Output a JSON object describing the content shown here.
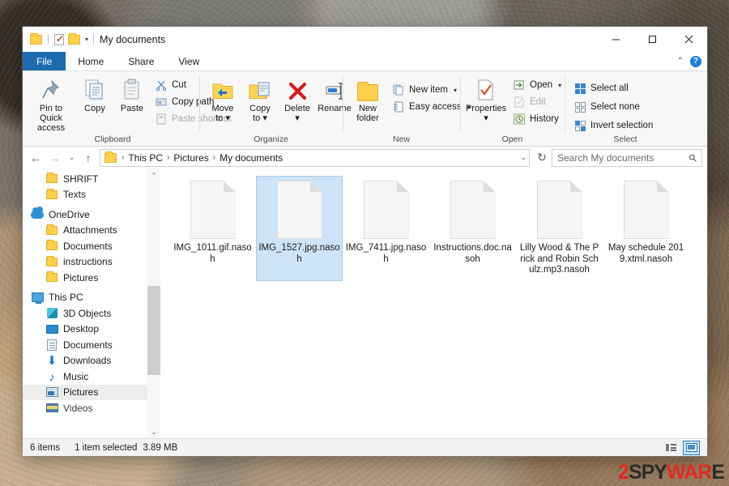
{
  "window": {
    "title": "My documents",
    "quick_access": [
      {
        "name": "folder-icon",
        "label": "Folder"
      },
      {
        "name": "properties-icon",
        "label": "Properties"
      },
      {
        "name": "new-folder-icon",
        "label": "New folder"
      },
      {
        "name": "customize-qat-caret",
        "label": "▾"
      }
    ],
    "controls": {
      "minimize": "—",
      "maximize": "▢",
      "close": "✕"
    }
  },
  "tabs": [
    {
      "id": "file",
      "label": "File"
    },
    {
      "id": "home",
      "label": "Home"
    },
    {
      "id": "share",
      "label": "Share"
    },
    {
      "id": "view",
      "label": "View"
    }
  ],
  "ribbon": {
    "collapse_caret": "⌃",
    "help_label": "?",
    "groups": [
      {
        "name": "Clipboard",
        "label": "Clipboard",
        "big_buttons": [
          {
            "name": "pin-to-quick-access",
            "label": "Pin to Quick\naccess",
            "line1": "Pin to Quick",
            "line2": "access"
          },
          {
            "name": "copy",
            "label": "Copy",
            "line1": "Copy",
            "line2": ""
          },
          {
            "name": "paste",
            "label": "Paste",
            "line1": "Paste",
            "line2": ""
          }
        ],
        "small_buttons": [
          {
            "name": "cut",
            "label": "Cut"
          },
          {
            "name": "copy-path",
            "label": "Copy path"
          },
          {
            "name": "paste-shortcut",
            "label": "Paste shortcut"
          }
        ]
      },
      {
        "name": "Organize",
        "label": "Organize",
        "big_buttons": [
          {
            "name": "move-to",
            "line1": "Move",
            "line2": "to ▾"
          },
          {
            "name": "copy-to",
            "line1": "Copy",
            "line2": "to ▾"
          },
          {
            "name": "delete",
            "line1": "Delete",
            "line2": "▾"
          },
          {
            "name": "rename",
            "line1": "Rename",
            "line2": ""
          }
        ]
      },
      {
        "name": "New",
        "label": "New",
        "big_buttons": [
          {
            "name": "new-folder",
            "line1": "New",
            "line2": "folder"
          }
        ],
        "small_buttons": [
          {
            "name": "new-item",
            "label": "New item"
          },
          {
            "name": "easy-access",
            "label": "Easy access"
          }
        ]
      },
      {
        "name": "Open",
        "label": "Open",
        "big_buttons": [
          {
            "name": "properties",
            "line1": "Properties",
            "line2": "▾"
          }
        ],
        "small_buttons": [
          {
            "name": "open",
            "label": "Open"
          },
          {
            "name": "edit",
            "label": "Edit"
          },
          {
            "name": "history",
            "label": "History"
          }
        ]
      },
      {
        "name": "Select",
        "label": "Select",
        "small_buttons": [
          {
            "name": "select-all",
            "label": "Select all"
          },
          {
            "name": "select-none",
            "label": "Select none"
          },
          {
            "name": "invert-selection",
            "label": "Invert selection"
          }
        ]
      }
    ]
  },
  "address": {
    "back": "←",
    "forward": "→",
    "recent_caret": "⌄",
    "up": "↑",
    "breadcrumbs": [
      "This PC",
      "Pictures",
      "My documents"
    ],
    "separator": "›",
    "dropdown_caret": "⌄",
    "refresh": "↻"
  },
  "search": {
    "placeholder": "Search My documents",
    "icon": "search-icon"
  },
  "navigation": {
    "items": [
      {
        "label": "SHRIFT",
        "icon": "folder-icon",
        "indent": 1,
        "selected": false
      },
      {
        "label": "Texts",
        "icon": "folder-icon",
        "indent": 1,
        "selected": false
      },
      {
        "label": "OneDrive",
        "icon": "cloud-icon",
        "indent": 0,
        "selected": false
      },
      {
        "label": "Attachments",
        "icon": "folder-icon",
        "indent": 1,
        "selected": false
      },
      {
        "label": "Documents",
        "icon": "folder-icon",
        "indent": 1,
        "selected": false
      },
      {
        "label": "instructions",
        "icon": "folder-icon",
        "indent": 1,
        "selected": false
      },
      {
        "label": "Pictures",
        "icon": "folder-icon",
        "indent": 1,
        "selected": false
      },
      {
        "label": "This PC",
        "icon": "computer-icon",
        "indent": 0,
        "selected": false
      },
      {
        "label": "3D Objects",
        "icon": "3d-objects-icon",
        "indent": 1,
        "selected": false
      },
      {
        "label": "Desktop",
        "icon": "desktop-icon",
        "indent": 1,
        "selected": false
      },
      {
        "label": "Documents",
        "icon": "documents-icon",
        "indent": 1,
        "selected": false
      },
      {
        "label": "Downloads",
        "icon": "downloads-icon",
        "indent": 1,
        "selected": false
      },
      {
        "label": "Music",
        "icon": "music-icon",
        "indent": 1,
        "selected": false
      },
      {
        "label": "Pictures",
        "icon": "pictures-icon",
        "indent": 1,
        "selected": true
      },
      {
        "label": "Videos",
        "icon": "videos-icon",
        "indent": 1,
        "selected": false
      }
    ],
    "scroll_up": "⌃",
    "scroll_down": "⌄"
  },
  "files": [
    {
      "name": "IMG_1011.gif.nasoh",
      "selected": false
    },
    {
      "name": "IMG_1527.jpg.nasoh",
      "selected": true
    },
    {
      "name": "IMG_7411.jpg.nasoh",
      "selected": false
    },
    {
      "name": "Instructions.doc.nasoh",
      "selected": false
    },
    {
      "name": "Lilly Wood & The Prick and Robin Schulz.mp3.nasoh",
      "selected": false
    },
    {
      "name": "May schedule 2019.xtml.nasoh",
      "selected": false
    }
  ],
  "status": {
    "item_count": "6 items",
    "selection": "1 item selected",
    "size": "3.89 MB",
    "view_details": "details-view-button",
    "view_large_icons": "large-icons-view-button"
  },
  "watermark": {
    "part1": "2",
    "part2": "SPY",
    "part3": "WAR",
    "part4": "E"
  },
  "colors": {
    "accent": "#1e6cb0",
    "selection": "#cde3f7",
    "folder": "#ffcf4d",
    "watermark_red": "#e02b22"
  }
}
